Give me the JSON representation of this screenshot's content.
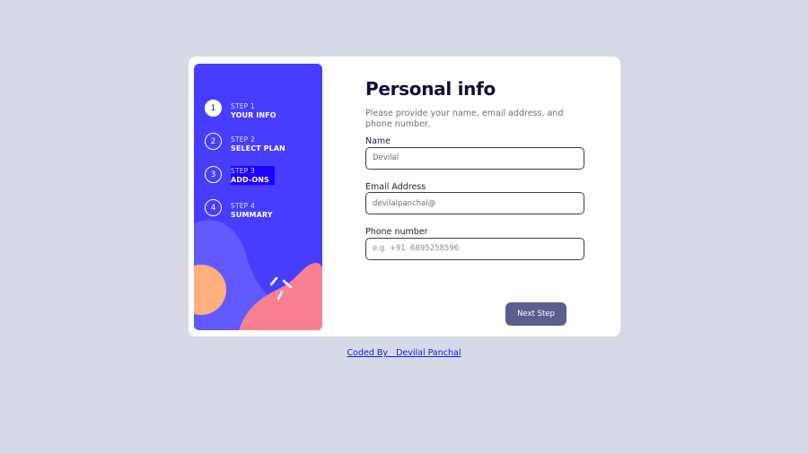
{
  "sidebar": {
    "steps": [
      {
        "number": "1",
        "label": "STEP 1",
        "title": "YOUR INFO"
      },
      {
        "number": "2",
        "label": "STEP 2",
        "title": "SELECT PLAN"
      },
      {
        "number": "3",
        "label": "STEP 3",
        "title": "ADD-ONS"
      },
      {
        "number": "4",
        "label": "STEP 4",
        "title": "SUMMARY"
      }
    ],
    "active_step": 1,
    "highlighted_step": 3
  },
  "form": {
    "title": "Personal info",
    "subtitle": "Please provide your name, email address, and phone number.",
    "fields": [
      {
        "label": "Name",
        "value": "Devilal",
        "placeholder": ""
      },
      {
        "label": "Email Address",
        "value": "devilalpanchal@",
        "placeholder": ""
      },
      {
        "label": "Phone number",
        "value": "",
        "placeholder": "e.g. +91  6895258596"
      }
    ],
    "next_label": "Next Step"
  },
  "footer": {
    "credit": "Coded By   Devilal Panchal"
  },
  "colors": {
    "background": "#d6dae6",
    "sidebar": "#473dff",
    "active_step": "#ffffff",
    "highlight": "#1d00ff",
    "button": "#5b5e8f",
    "blob_orange": "#ffaf7e",
    "blob_pink": "#f9818e",
    "blob_purple": "#6259ff"
  }
}
